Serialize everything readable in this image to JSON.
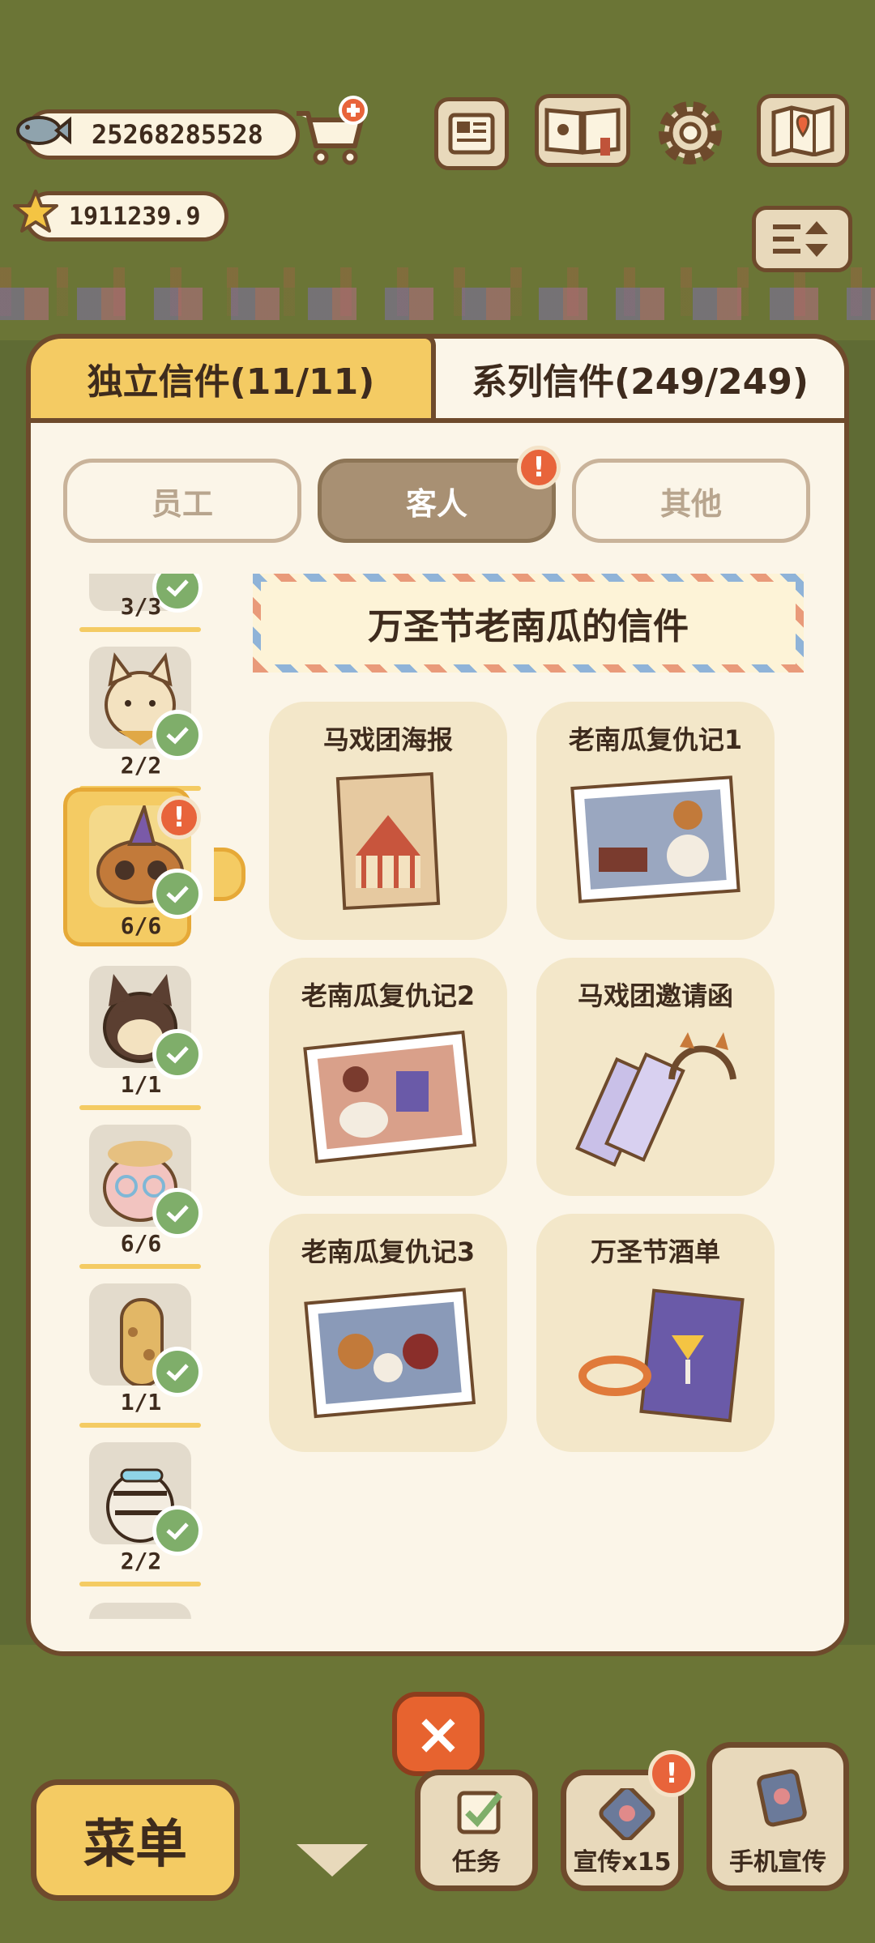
{
  "currency": {
    "fish_amount": "25268285528",
    "star_amount": "1911239.9"
  },
  "top_buttons": [
    "newspaper-icon",
    "book-icon",
    "gear-icon",
    "map-icon",
    "sort-icon"
  ],
  "tabs": {
    "individual": "独立信件(11/11)",
    "series": "系列信件(249/249)"
  },
  "categories": {
    "staff": "员工",
    "guests": "客人",
    "other": "其他",
    "alert": "!"
  },
  "characters": [
    {
      "count": "3/3"
    },
    {
      "count": "2/2"
    },
    {
      "count": "6/6"
    },
    {
      "count": "1/1"
    },
    {
      "count": "6/6"
    },
    {
      "count": "1/1"
    },
    {
      "count": "2/2"
    }
  ],
  "series_title": "万圣节老南瓜的信件",
  "letters": [
    {
      "title": "马戏团海报"
    },
    {
      "title": "老南瓜复仇记1"
    },
    {
      "title": "老南瓜复仇记2"
    },
    {
      "title": "马戏团邀请函"
    },
    {
      "title": "老南瓜复仇记3"
    },
    {
      "title": "万圣节酒单"
    }
  ],
  "bottom": {
    "close": "×",
    "menu": "菜单",
    "tasks": "任务",
    "promote": "宣传x15",
    "phone_promote": "手机宣传"
  },
  "colors": {
    "accent_yellow": "#f4cb63",
    "panel_bg": "#fbf5e8",
    "outline": "#6e4a2c",
    "alert_orange": "#e8643b",
    "check_green": "#7fae6a"
  }
}
